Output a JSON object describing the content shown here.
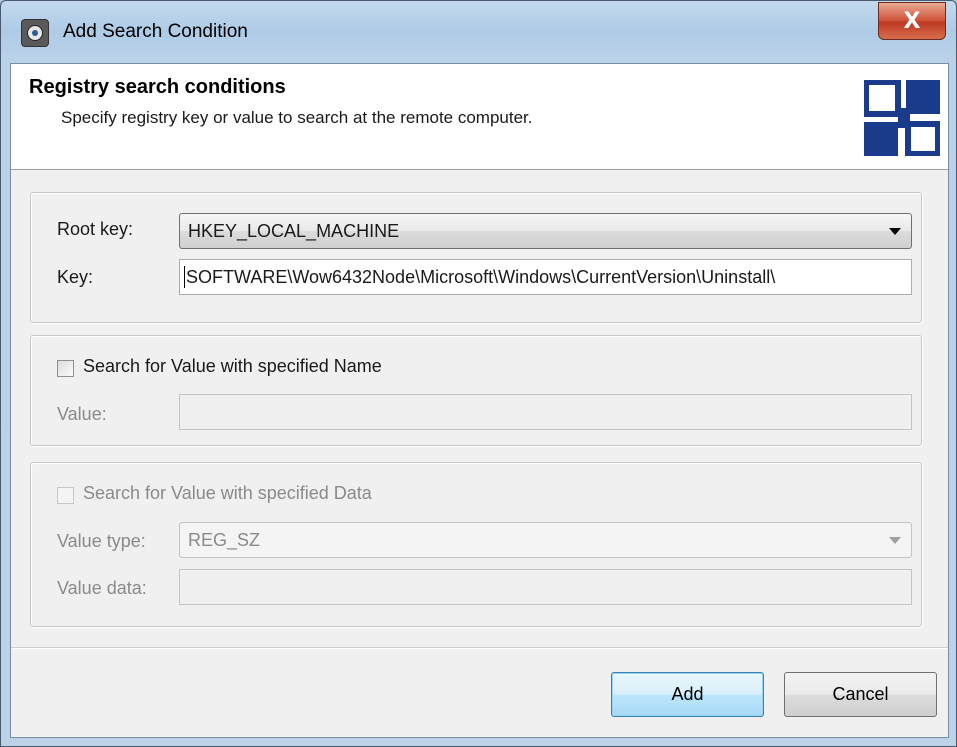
{
  "window": {
    "title": "Add Search Condition",
    "close_label": "X"
  },
  "header": {
    "title": "Registry search conditions",
    "subtitle": "Specify registry key or value to search at the remote computer.",
    "logo_icon": "registry-blocks-icon",
    "accent_color": "#1a3a8c"
  },
  "key_group": {
    "root_key_label": "Root key:",
    "root_key_value": "HKEY_LOCAL_MACHINE",
    "key_label": "Key:",
    "key_value": "SOFTWARE\\Wow6432Node\\Microsoft\\Windows\\CurrentVersion\\Uninstall\\"
  },
  "name_group": {
    "checkbox_label": "Search for Value with specified Name",
    "checked": false,
    "value_label": "Value:",
    "value": ""
  },
  "data_group": {
    "checkbox_label": "Search for Value with specified Data",
    "checked": false,
    "value_type_label": "Value type:",
    "value_type": "REG_SZ",
    "value_data_label": "Value data:",
    "value_data": ""
  },
  "buttons": {
    "add": "Add",
    "cancel": "Cancel"
  }
}
